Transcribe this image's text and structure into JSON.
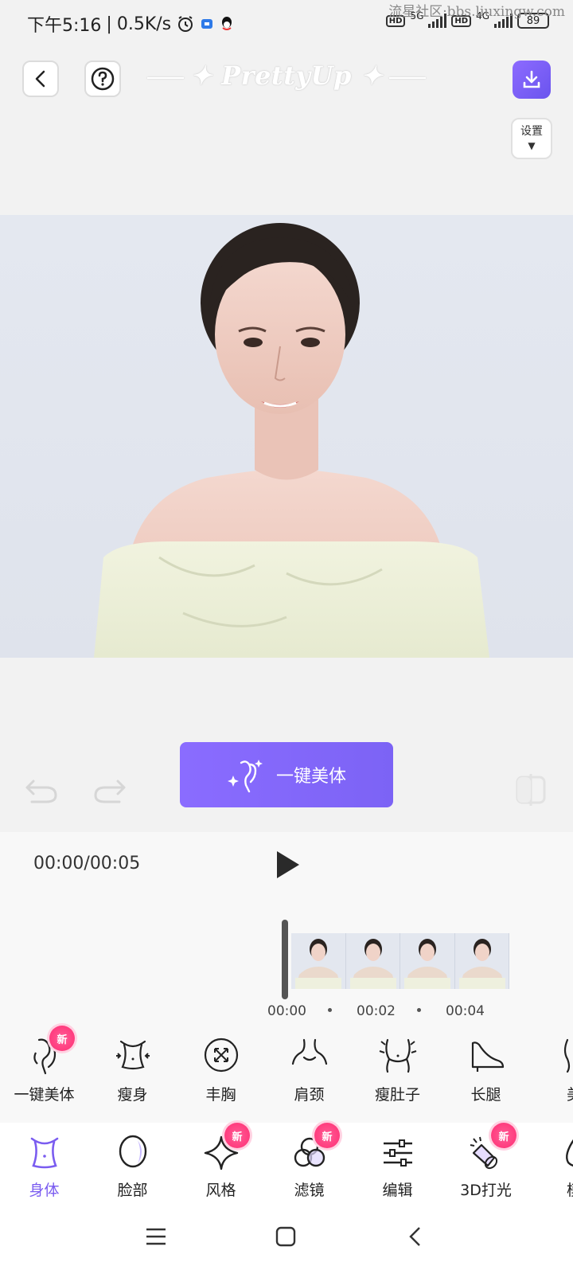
{
  "status_bar": {
    "time": "下午5:16",
    "speed": "0.5K/s",
    "network1": "5G",
    "network2": "4G",
    "hd": "HD",
    "battery": "89",
    "watermark": "流星社区·bbs.liuxingw.com"
  },
  "header": {
    "logo_text": "PrettyUp",
    "settings_label": "设置",
    "settings_arrow": "▼",
    "icons": [
      "back-icon",
      "help-icon",
      "download-icon"
    ]
  },
  "editor": {
    "one_tap_button_label": "一键美体",
    "time_display": "00:00/00:05",
    "timeline_ticks": [
      "00:00",
      "00:02",
      "00:04"
    ]
  },
  "body_tools": [
    {
      "label": "一键美体",
      "icon": "body-beauty-icon",
      "badge": "新"
    },
    {
      "label": "瘦身",
      "icon": "slim-body-icon"
    },
    {
      "label": "丰胸",
      "icon": "bust-icon"
    },
    {
      "label": "肩颈",
      "icon": "shoulder-neck-icon"
    },
    {
      "label": "瘦肚子",
      "icon": "belly-icon"
    },
    {
      "label": "长腿",
      "icon": "long-legs-icon"
    },
    {
      "label": "美",
      "icon": "beauty-icon"
    }
  ],
  "bottom_tabs": [
    {
      "label": "身体",
      "icon": "body-tab-icon",
      "active": true
    },
    {
      "label": "脸部",
      "icon": "face-tab-icon"
    },
    {
      "label": "风格",
      "icon": "style-tab-icon",
      "badge": "新"
    },
    {
      "label": "滤镜",
      "icon": "filter-tab-icon",
      "badge": "新"
    },
    {
      "label": "编辑",
      "icon": "edit-tab-icon"
    },
    {
      "label": "3D打光",
      "icon": "lighting-tab-icon",
      "badge": "新"
    },
    {
      "label": "模",
      "icon": "template-tab-icon"
    }
  ],
  "colors": {
    "accent": "#7a5cf0",
    "badge": "#ff3c7e",
    "button_gradient_start": "#8a6cff",
    "button_gradient_end": "#7c63f5"
  }
}
